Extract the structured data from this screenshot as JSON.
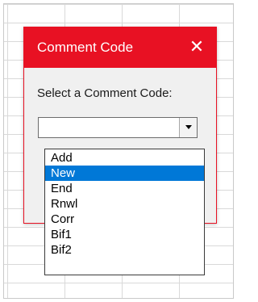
{
  "dialog": {
    "title": "Comment Code",
    "close_glyph": "✕",
    "prompt": "Select a Comment Code:",
    "combo_value": "",
    "combo_arrow_icon": "chevron-down-icon",
    "accent_color": "#e81123"
  },
  "dropdown": {
    "selected_index": 1,
    "selected_color": "#0078d7",
    "items": [
      {
        "label": "Add"
      },
      {
        "label": "New"
      },
      {
        "label": "End"
      },
      {
        "label": "Rnwl"
      },
      {
        "label": "Corr"
      },
      {
        "label": "Bif1"
      },
      {
        "label": "Bif2"
      }
    ]
  }
}
